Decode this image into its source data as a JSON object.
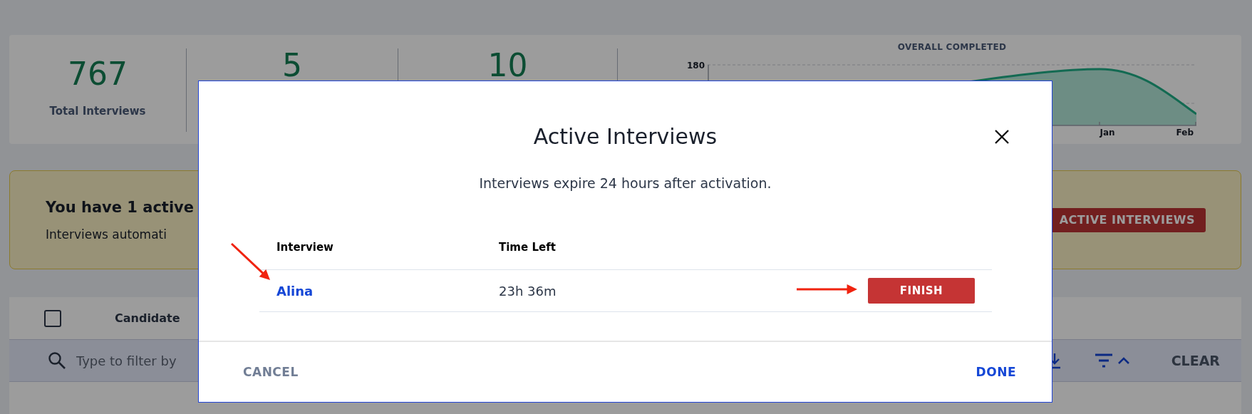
{
  "stats": [
    {
      "value": "767",
      "label": "Total Interviews"
    },
    {
      "value": "5"
    },
    {
      "value": "10"
    }
  ],
  "chart": {
    "title": "OVERALL COMPLETED",
    "y_tick_label": "180",
    "x_labels": [
      "Jan",
      "Feb"
    ]
  },
  "banner": {
    "title": "You have 1 active",
    "text": "Interviews automati",
    "button": "ACTIVE INTERVIEWS"
  },
  "table": {
    "select_all_checked": false,
    "columns": [
      "Candidate"
    ],
    "filter_placeholder": "Type to filter by",
    "clear": "CLEAR"
  },
  "dialog": {
    "title": "Active Interviews",
    "subtitle": "Interviews expire 24 hours after activation.",
    "columns": [
      "Interview",
      "Time Left"
    ],
    "rows": [
      {
        "interview": "Alina",
        "time_left": "23h 36m",
        "action": "FINISH"
      }
    ],
    "cancel": "CANCEL",
    "done": "DONE"
  }
}
